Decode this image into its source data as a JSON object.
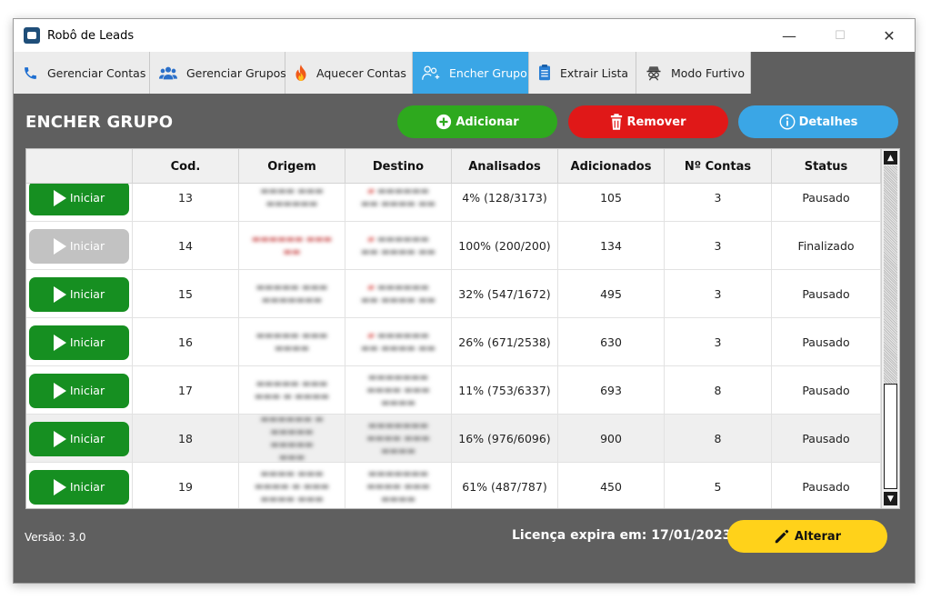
{
  "window": {
    "title": "Robô de Leads",
    "controls": {
      "minimize": "—",
      "maximize": "☐",
      "close": "✕"
    }
  },
  "tabs": [
    {
      "label": "Gerenciar Contas",
      "icon": "phone-icon",
      "glyph": "📞"
    },
    {
      "label": "Gerenciar Grupos",
      "icon": "group-icon",
      "glyph": "👥"
    },
    {
      "label": "Aquecer Contas",
      "icon": "fire-icon",
      "glyph": "🔥"
    },
    {
      "label": "Encher Grupo",
      "icon": "add-users-icon",
      "glyph": "👤"
    },
    {
      "label": "Extrair Lista",
      "icon": "list-icon",
      "glyph": "📋"
    },
    {
      "label": "Modo Furtivo",
      "icon": "spy-icon",
      "glyph": "🕵"
    }
  ],
  "active_tab": "Encher Grupo",
  "section_title": "ENCHER GRUPO",
  "actions": {
    "add": {
      "label": "Adicionar",
      "icon": "plus-circle-icon",
      "color": "#2ea91e"
    },
    "remove": {
      "label": "Remover",
      "icon": "trash-icon",
      "color": "#e01818"
    },
    "details": {
      "label": "Detalhes",
      "icon": "info-icon",
      "color": "#3aa6e6"
    }
  },
  "table": {
    "headers": [
      "",
      "Cod.",
      "Origem",
      "Destino",
      "Analisados",
      "Adicionados",
      "Nº Contas",
      "Status"
    ],
    "button_label": "Iniciar",
    "rows": [
      {
        "cod": "13",
        "analisados": "4% (128/3173)",
        "adicionados": "105",
        "contas": "3",
        "status": "Pausado",
        "finished": false
      },
      {
        "cod": "14",
        "analisados": "100% (200/200)",
        "adicionados": "134",
        "contas": "3",
        "status": "Finalizado",
        "finished": true
      },
      {
        "cod": "15",
        "analisados": "32% (547/1672)",
        "adicionados": "495",
        "contas": "3",
        "status": "Pausado",
        "finished": false
      },
      {
        "cod": "16",
        "analisados": "26% (671/2538)",
        "adicionados": "630",
        "contas": "3",
        "status": "Pausado",
        "finished": false
      },
      {
        "cod": "17",
        "analisados": "11% (753/6337)",
        "adicionados": "693",
        "contas": "8",
        "status": "Pausado",
        "finished": false
      },
      {
        "cod": "18",
        "analisados": "16% (976/6096)",
        "adicionados": "900",
        "contas": "8",
        "status": "Pausado",
        "finished": false
      },
      {
        "cod": "19",
        "analisados": "61% (487/787)",
        "adicionados": "450",
        "contas": "5",
        "status": "Pausado",
        "finished": false
      }
    ]
  },
  "footer": {
    "version": "Versão: 3.0",
    "license": "Licença expira em: 17/01/2023",
    "alter_label": "Alterar"
  },
  "colors": {
    "background": "#5f5f5f",
    "accent": "#3aa6e6",
    "start_green": "#168f21",
    "alter_yellow": "#ffd21a"
  }
}
